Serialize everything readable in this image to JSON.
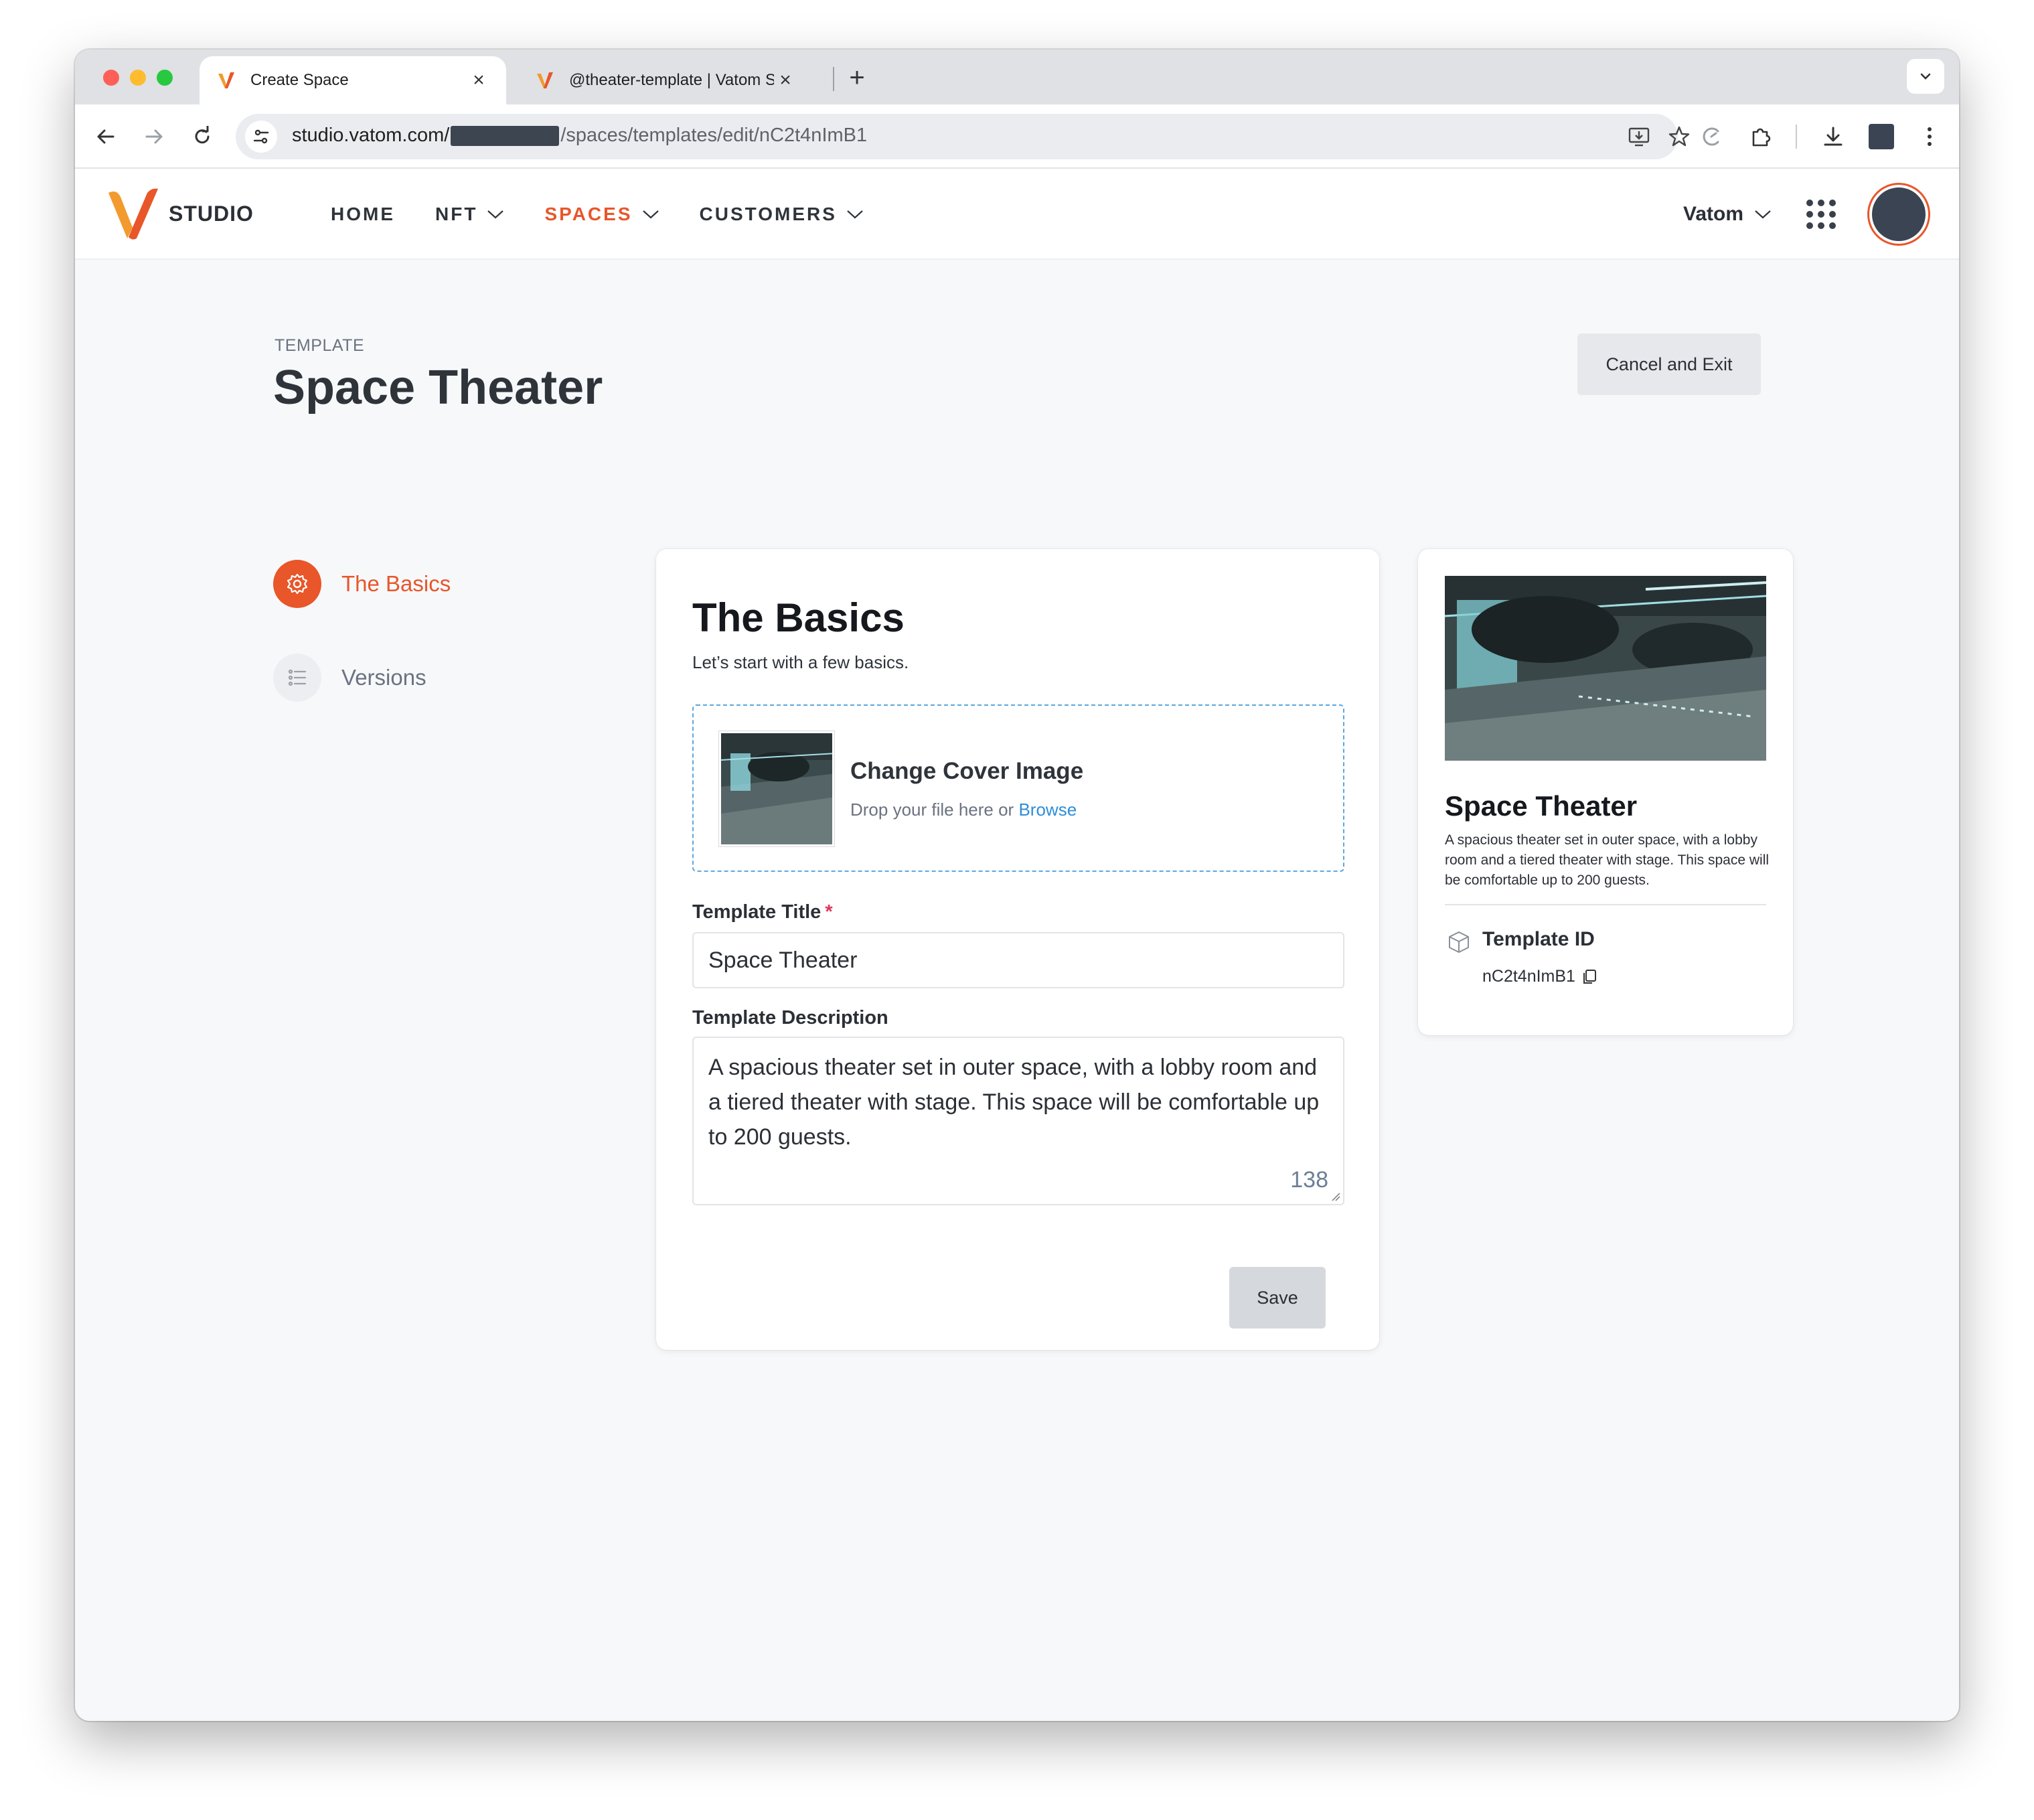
{
  "browser": {
    "tabs": [
      {
        "title": "Create Space",
        "active": true
      },
      {
        "title": "@theater-template | Vatom Sp",
        "active": false
      }
    ],
    "url": {
      "host": "studio.vatom.com/",
      "path": "/spaces/templates/edit/nC2t4nImB1"
    },
    "icons": {
      "back": "arrow-left-icon",
      "forward": "arrow-right-icon",
      "reload": "reload-icon",
      "site_settings": "tune-icon",
      "install": "install-app-icon",
      "bookmark": "star-icon",
      "extension": "puzzle-icon",
      "download": "download-icon",
      "menu": "kebab-menu-icon"
    }
  },
  "header": {
    "brand": "STUDIO",
    "nav": [
      {
        "label": "HOME",
        "dropdown": false,
        "active": false
      },
      {
        "label": "NFT",
        "dropdown": true,
        "active": false
      },
      {
        "label": "SPACES",
        "dropdown": true,
        "active": true
      },
      {
        "label": "CUSTOMERS",
        "dropdown": true,
        "active": false
      }
    ],
    "org": "Vatom",
    "accent_color": "#e8562a"
  },
  "page": {
    "eyebrow": "TEMPLATE",
    "title": "Space Theater",
    "cancel_label": "Cancel and Exit"
  },
  "steps": [
    {
      "label": "The Basics",
      "active": true,
      "icon": "gear-icon"
    },
    {
      "label": "Versions",
      "active": false,
      "icon": "list-icon"
    }
  ],
  "form": {
    "heading": "The Basics",
    "subheading": "Let’s start with a few basics.",
    "cover": {
      "title": "Change Cover Image",
      "hint": "Drop your file here or",
      "browse": "Browse"
    },
    "title_label": "Template Title",
    "required_mark": "*",
    "title_value": "Space Theater",
    "description_label": "Template Description",
    "description_value": "A spacious theater set in outer space, with a lobby room and a tiered theater with stage. This space will be comfortable up to 200 guests.",
    "char_count": "138",
    "save_label": "Save"
  },
  "preview": {
    "title": "Space Theater",
    "description": "A spacious theater set in outer space, with a lobby room and a tiered theater with stage. This space will be comfortable up to 200 guests.",
    "id_label": "Template ID",
    "id_value": "nC2t4nImB1"
  }
}
